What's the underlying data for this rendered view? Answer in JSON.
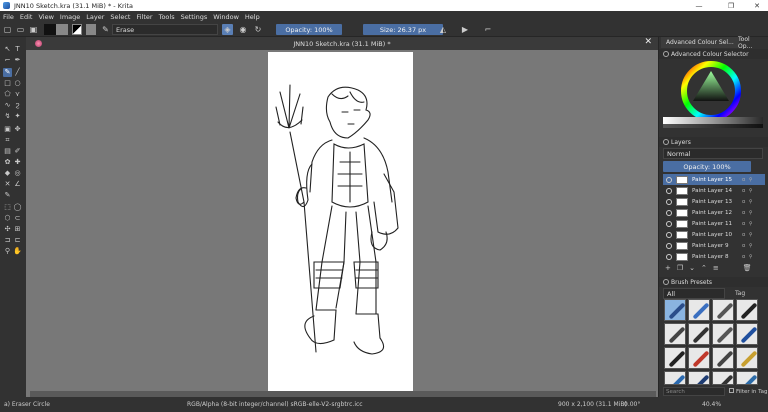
{
  "window": {
    "title": "JNN10 Sketch.kra (31.1 MiB) * - Krita",
    "minimize": "—",
    "maximize": "❐",
    "close": "✕"
  },
  "menu": [
    "File",
    "Edit",
    "View",
    "Image",
    "Layer",
    "Select",
    "Filter",
    "Tools",
    "Settings",
    "Window",
    "Help"
  ],
  "toolbar": {
    "blend_mode": "Erase",
    "opacity": "Opacity: 100%",
    "size": "Size: 26.37 px"
  },
  "document_tab": {
    "title": "JNN10 Sketch.kra (31.1 MiB) *",
    "close": "✕"
  },
  "right_panel": {
    "tabs": [
      "Advanced Colour Sel...",
      "Tool Op..."
    ],
    "colour_selector_title": "Advanced Colour Selector",
    "layers_title": "Layers",
    "blend_mode": "Normal",
    "opacity": "Opacity: 100%",
    "layers": [
      {
        "name": "Paint Layer 15",
        "selected": true
      },
      {
        "name": "Paint Layer 14",
        "selected": false
      },
      {
        "name": "Paint Layer 13",
        "selected": false
      },
      {
        "name": "Paint Layer 12",
        "selected": false
      },
      {
        "name": "Paint Layer 11",
        "selected": false
      },
      {
        "name": "Paint Layer 10",
        "selected": false
      },
      {
        "name": "Paint Layer 9",
        "selected": false
      },
      {
        "name": "Paint Layer 8",
        "selected": false
      }
    ],
    "brush_presets_title": "Brush Presets",
    "preset_filter": "All",
    "tag_label": "Tag",
    "search_placeholder": "Search",
    "filter_in_tag": "Filter in Tag"
  },
  "status": {
    "tool": "a) Eraser Circle",
    "color_info": "RGB/Alpha (8-bit integer/channel)  sRGB-elle-V2-srgbtrc.icc",
    "dimensions": "900 x 2,100 (31.1 MiB)",
    "rotation": "0.00°",
    "zoom": "40.4%"
  },
  "colors": {
    "accent": "#4a6ea3",
    "background": "#323232",
    "canvas_bg": "#787878"
  }
}
